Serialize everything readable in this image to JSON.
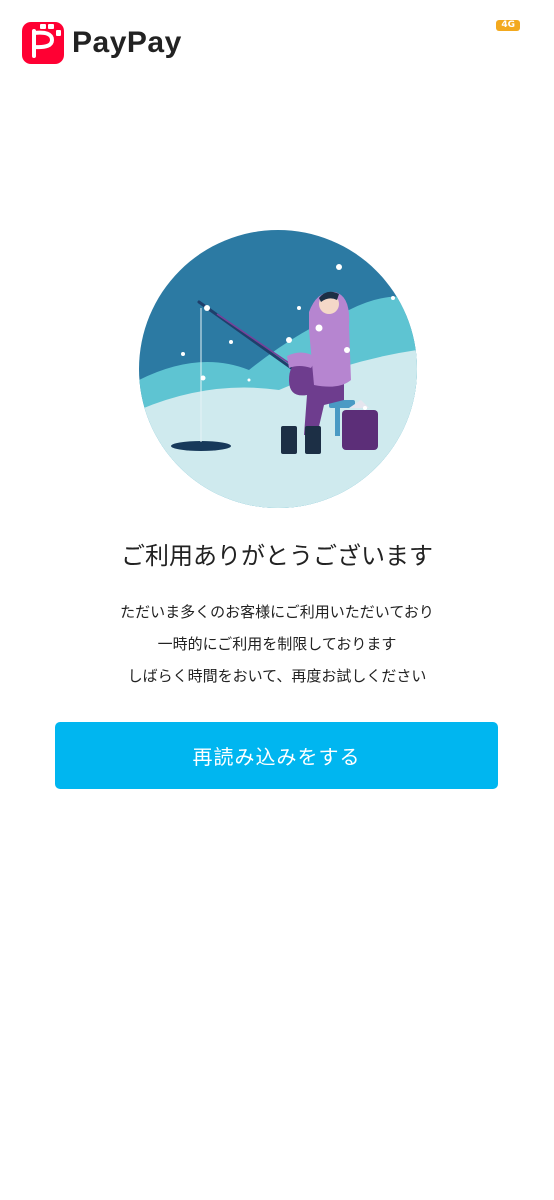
{
  "app": {
    "logo_text": "PayPay",
    "logo_icon": "paypay-logo-icon",
    "brand_color": "#ff0033"
  },
  "status": {
    "chip_text": "4G"
  },
  "illustration": {
    "icon": "ice-fishing-illustration"
  },
  "main": {
    "title": "ご利用ありがとうございます",
    "message_lines": [
      "ただいま多くのお客様にご利用いただいており",
      "一時的にご利用を制限しております",
      "しばらく時間をおいて、再度お試しください"
    ]
  },
  "actions": {
    "reload_label": "再読み込みをする",
    "reload_color": "#00b6f0"
  }
}
